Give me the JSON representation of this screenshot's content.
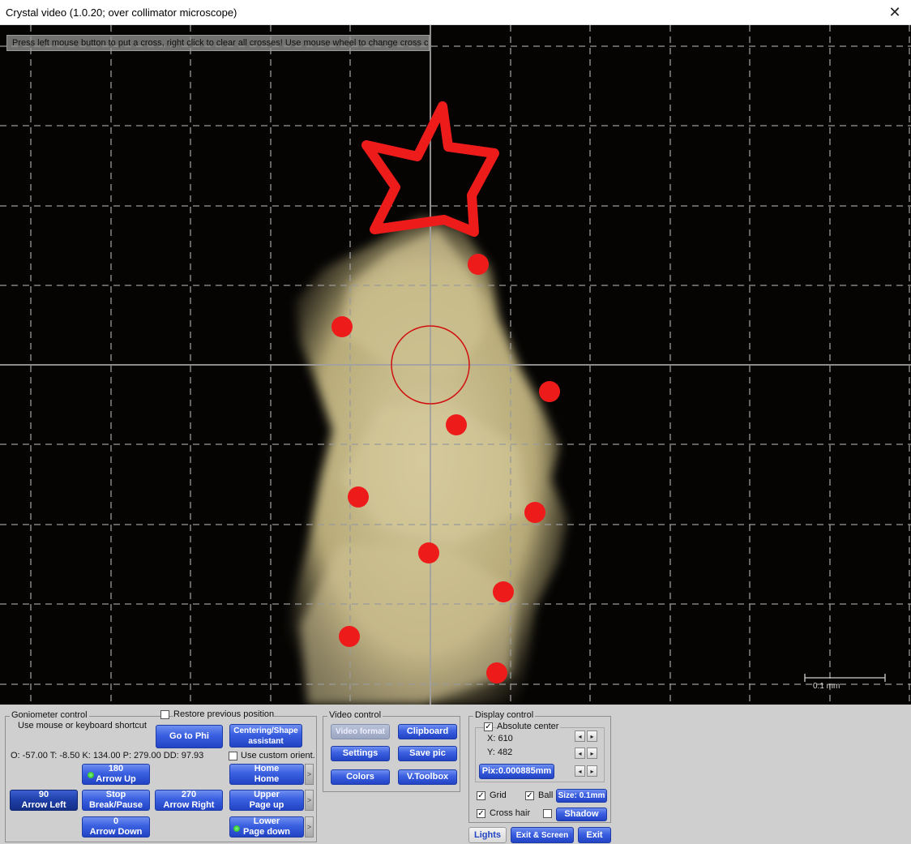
{
  "window": {
    "title": "Crystal video (1.0.20; over collimator microscope)",
    "close_glyph": "✕"
  },
  "viewport": {
    "hint": "Press left mouse button to put a cross, right click to clear all crosses! Use mouse wheel to change cross color",
    "scale_label": "0.1 mm",
    "ornament_color": "#ee1b1b",
    "grid_color": "#9a9a9a"
  },
  "goniometer": {
    "group_title": "Goniometer control",
    "restore_label": "Restore previous position",
    "restore_checked": false,
    "shortcut_hint": "Use mouse or keyboard shortcut",
    "go_to_phi": "Go to Phi",
    "centering_line1": "Centering/Shape",
    "centering_line2": "assistant",
    "readout": "O: -57.00 T:   -8.50 K: 134.00 P: 279.00 DD:  97.93",
    "custom_orient_label": "Use custom orient.",
    "custom_orient_checked": false,
    "arrow_up_value": "180",
    "arrow_up_label": "Arrow Up",
    "arrow_left_value": "90",
    "arrow_left_label": "Arrow Left",
    "stop_label": "Stop",
    "break_label": "Break/Pause",
    "arrow_right_value": "270",
    "arrow_right_label": "Arrow Right",
    "arrow_down_value": "0",
    "arrow_down_label": "Arrow Down",
    "home_line1": "Home",
    "home_line2": "Home",
    "upper_line1": "Upper",
    "upper_line2": "Page up",
    "lower_line1": "Lower",
    "lower_line2": "Page down",
    "side_arrow": ">"
  },
  "video": {
    "group_title": "Video control",
    "video_format": "Video format",
    "clipboard": "Clipboard",
    "settings": "Settings",
    "save_pic": "Save pic",
    "colors": "Colors",
    "toolbox": "V.Toolbox"
  },
  "display": {
    "group_title": "Display control",
    "absolute_center_label": "Absolute center",
    "absolute_center_checked": true,
    "x_label": "X: 610",
    "y_label": "Y: 482",
    "pix_label": "Pix:0.000885mm",
    "spin_left": "◂",
    "spin_right": "▸",
    "grid_label": "Grid",
    "grid_checked": true,
    "ball_label": "Ball",
    "ball_checked": true,
    "size_label": "Size: 0.1mm",
    "crosshair_label": "Cross hair",
    "crosshair_checked": true,
    "shadow_label": "Shadow",
    "shadow_checked": false
  },
  "bottom": {
    "lights": "Lights",
    "exit_screen": "Exit & Screen",
    "exit": "Exit"
  }
}
